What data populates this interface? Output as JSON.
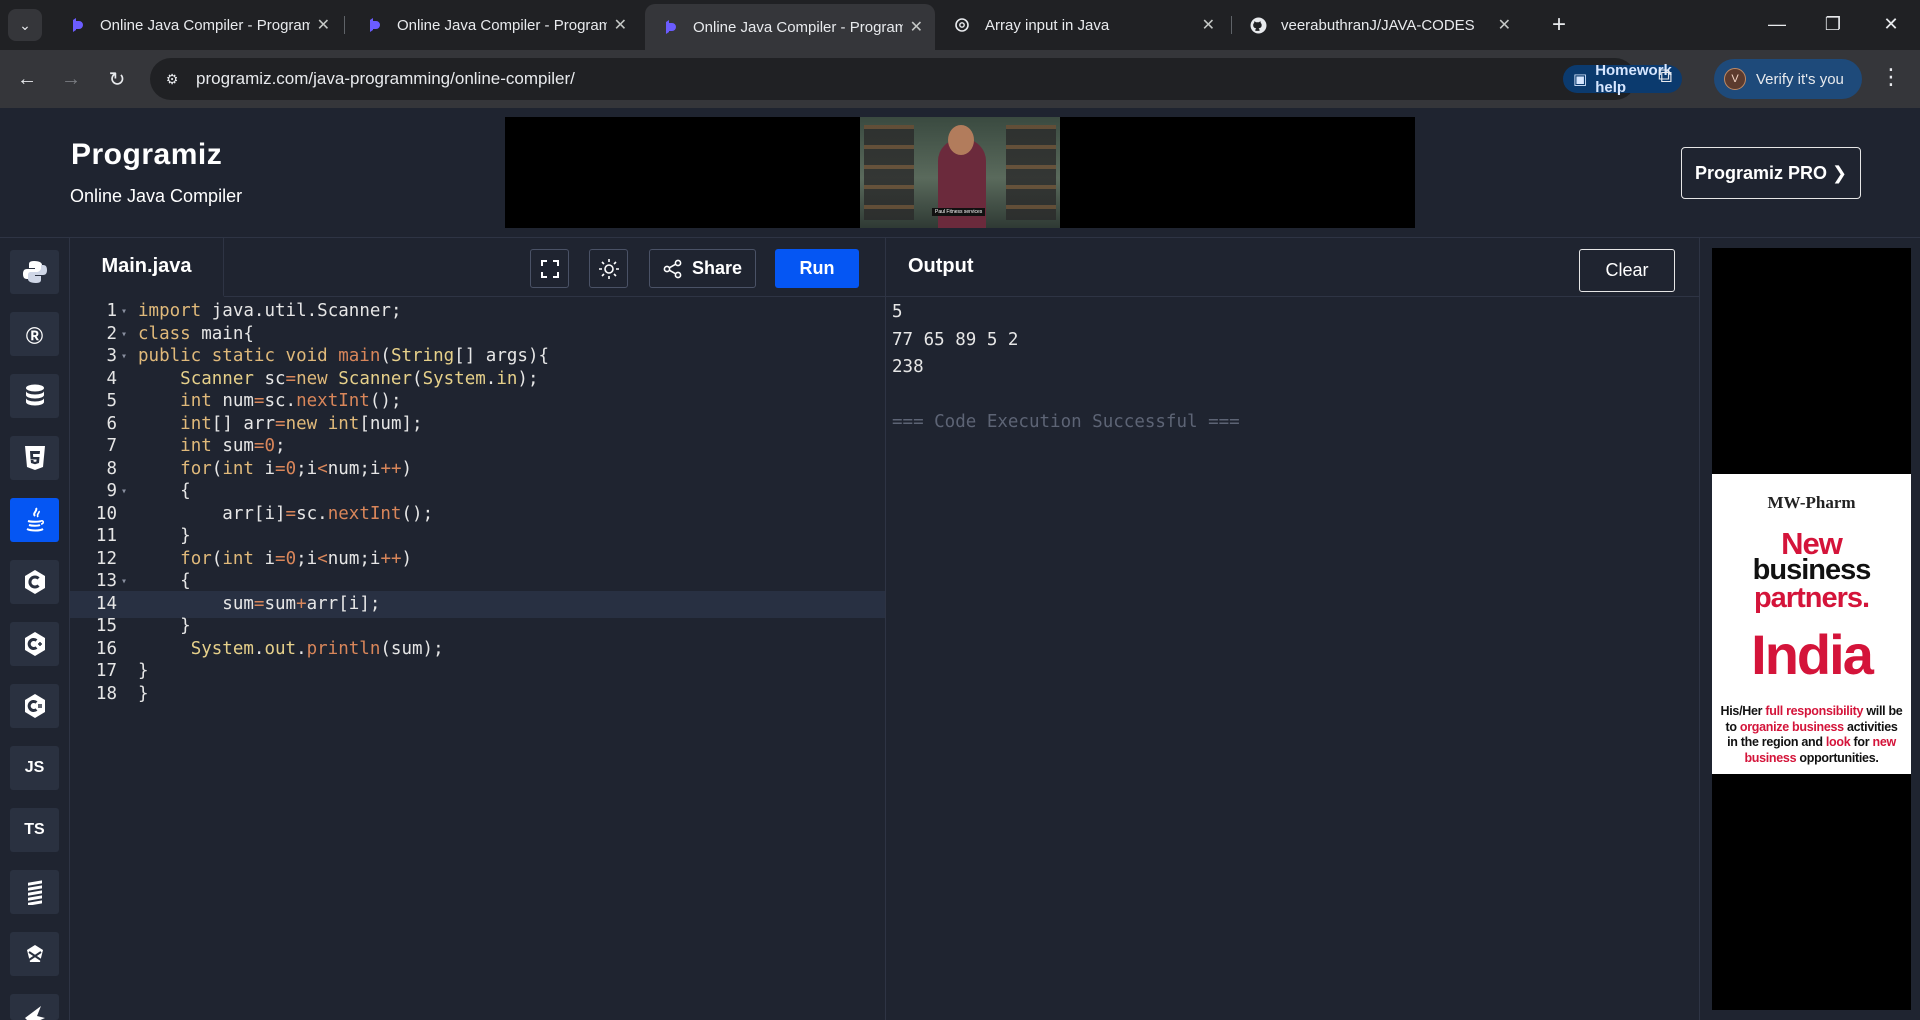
{
  "browser": {
    "tabs": [
      {
        "title": "Online Java Compiler - Programiz",
        "icon": "programiz-icon",
        "active": false
      },
      {
        "title": "Online Java Compiler - Programiz",
        "icon": "programiz-icon",
        "active": false
      },
      {
        "title": "Online Java Compiler - Programiz",
        "icon": "programiz-icon",
        "active": true
      },
      {
        "title": "Array input in Java",
        "icon": "chatgpt-icon",
        "active": false
      },
      {
        "title": "veerabuthranJ/JAVA-CODES",
        "icon": "github-icon",
        "active": false
      }
    ],
    "url": "programiz.com/java-programming/online-compiler/",
    "homework_help": "Homework help",
    "profile_label": "Verify it's you",
    "profile_initial": "V"
  },
  "header": {
    "logo": "Programiz",
    "subtitle": "Online Java Compiler",
    "pro_button": "Programiz PRO ❯",
    "ad_caption": "Paul Fitness services"
  },
  "sidebar": {
    "languages": [
      {
        "name": "python-icon",
        "glyph": "🐍",
        "active": false
      },
      {
        "name": "r-icon",
        "glyph": "R",
        "active": false
      },
      {
        "name": "sql-icon",
        "glyph": "≡",
        "active": false
      },
      {
        "name": "html-icon",
        "glyph": "5",
        "active": false
      },
      {
        "name": "java-icon",
        "glyph": "☕",
        "active": true
      },
      {
        "name": "c-icon",
        "glyph": "C",
        "active": false
      },
      {
        "name": "cpp-icon",
        "glyph": "C+",
        "active": false
      },
      {
        "name": "csharp-icon",
        "glyph": "C#",
        "active": false
      },
      {
        "name": "js-icon",
        "glyph": "JS",
        "active": false
      },
      {
        "name": "ts-icon",
        "glyph": "TS",
        "active": false
      },
      {
        "name": "go-icon",
        "glyph": "≣",
        "active": false
      },
      {
        "name": "php-icon",
        "glyph": "◈",
        "active": false
      },
      {
        "name": "swift-icon",
        "glyph": "➶",
        "active": false
      }
    ]
  },
  "editor": {
    "filename": "Main.java",
    "share_label": "Share",
    "run_label": "Run",
    "lines": [
      "import java.util.Scanner;",
      "class main{",
      "public static void main(String[] args){",
      "    Scanner sc=new Scanner(System.in);",
      "    int num=sc.nextInt();",
      "    int[] arr=new int[num];",
      "    int sum=0;",
      "    for(int i=0;i<num;i++)",
      "    {",
      "        arr[i]=sc.nextInt();",
      "    }",
      "    for(int i=0;i<num;i++)",
      "    {",
      "        sum=sum+arr[i];",
      "    }",
      "     System.out.println(sum);",
      "}",
      "}"
    ],
    "fold_lines": [
      1,
      2,
      3,
      9,
      13
    ],
    "highlighted_line": 14
  },
  "output": {
    "title": "Output",
    "clear_label": "Clear",
    "lines": [
      "5",
      "77 65 89 5 2",
      "238",
      "",
      "=== Code Execution Successful ==="
    ]
  },
  "right_ad": {
    "brand": "MW-Pharm",
    "headline_1": "New",
    "headline_2": "business",
    "headline_3": "partners.",
    "country": "India",
    "body_1": "His/Her ",
    "body_2": "full responsibility",
    "body_3": " will be to ",
    "body_4": "organize business",
    "body_5": " activities in the region and ",
    "body_6": "look",
    "body_7": " for ",
    "body_8": "new business",
    "body_9": " opportunities."
  }
}
